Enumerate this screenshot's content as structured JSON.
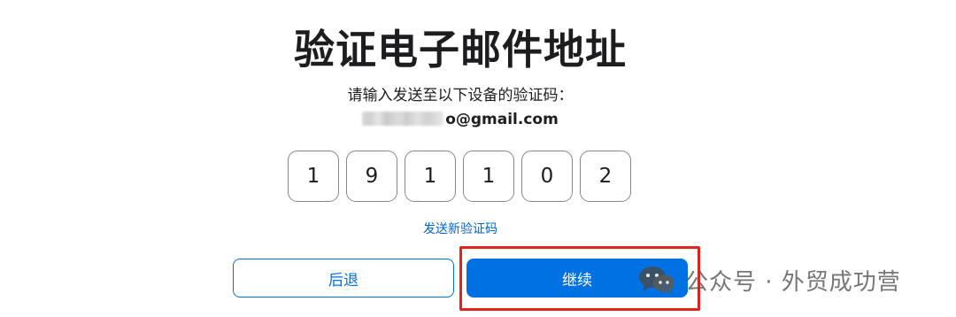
{
  "page": {
    "title": "验证电子邮件地址",
    "subtitle": "请输入发送至以下设备的验证码：",
    "email_visible_part": "o@gmail.com"
  },
  "code": {
    "digits": [
      "1",
      "9",
      "1",
      "1",
      "0",
      "2"
    ]
  },
  "links": {
    "resend_label": "发送新验证码"
  },
  "buttons": {
    "back_label": "后退",
    "continue_label": "继续"
  },
  "watermark": {
    "text": "公众号 · 外贸成功营",
    "icon": "wechat-icon"
  },
  "colors": {
    "accent": "#0071e3",
    "link": "#0066cc",
    "highlight": "#e2231a",
    "text": "#1d1d1f"
  }
}
